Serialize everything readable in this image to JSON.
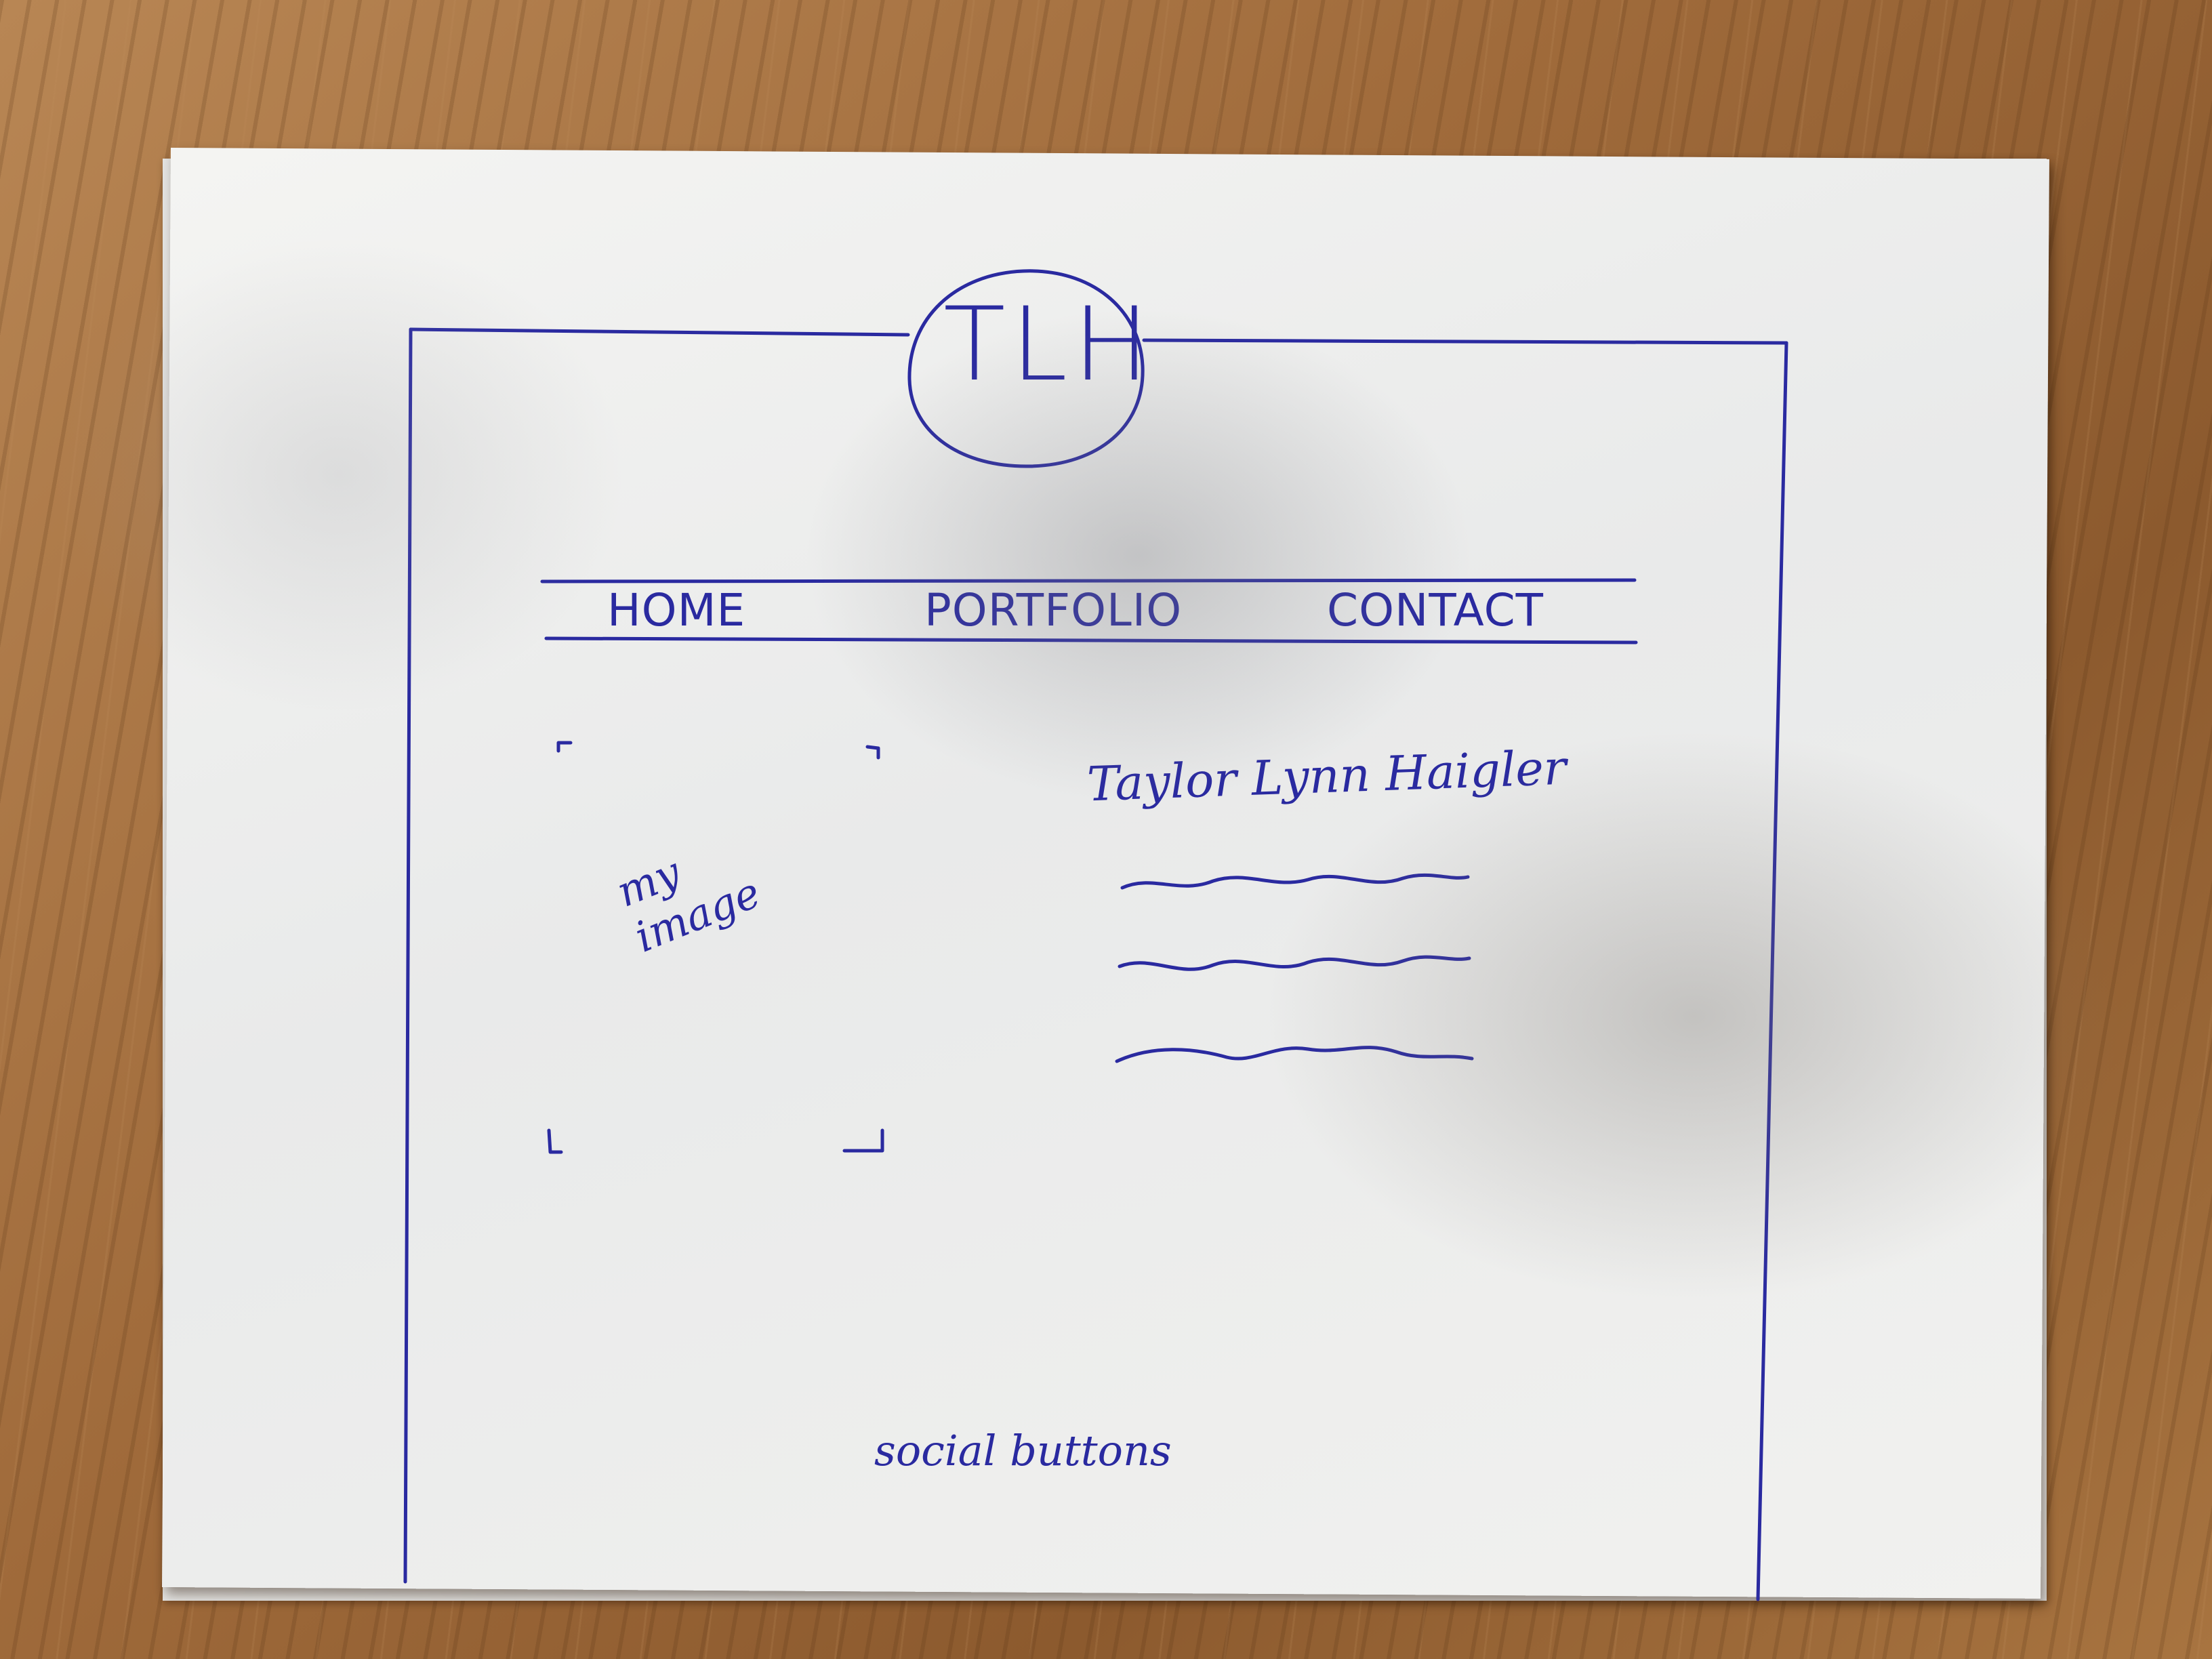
{
  "header": {
    "logo_text": "TLH"
  },
  "nav": {
    "items": [
      {
        "label": "HOME"
      },
      {
        "label": "PORTFOLIO"
      },
      {
        "label": "CONTACT"
      }
    ]
  },
  "hero": {
    "image_placeholder_label": "my\nimage",
    "name": "Taylor Lynn Haigler",
    "text_placeholder_lines": 3
  },
  "footer": {
    "social_label": "social buttons"
  },
  "colors": {
    "ink": "#2a2aa0",
    "paper": "#f1f1ef",
    "table": "#a06b3b"
  }
}
